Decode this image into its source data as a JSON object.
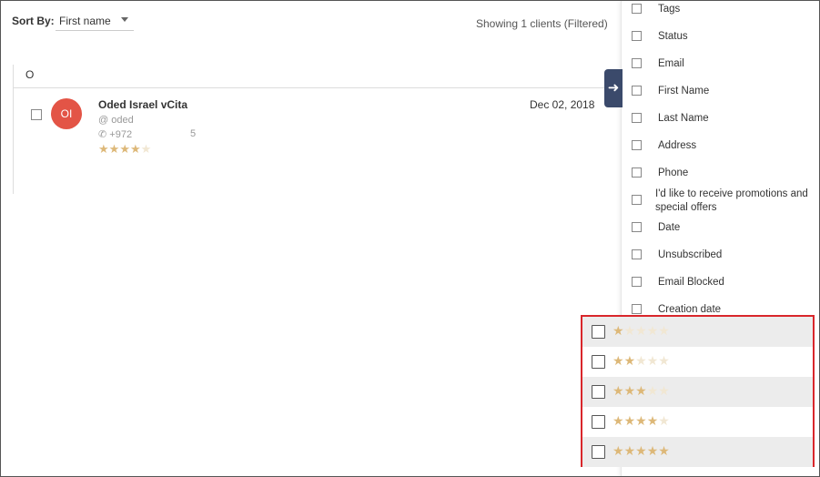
{
  "toolbar": {
    "sort_label": "Sort By:",
    "sort_value": "First name",
    "showing_text": "Showing 1 clients (Filtered)"
  },
  "list": {
    "group_letter": "O",
    "row": {
      "initials": "OI",
      "name": "Oded Israel vCita",
      "email_prefix": "@ oded",
      "phone_prefix": "+972",
      "phone_suffix": "5",
      "rating": 4,
      "date": "Dec 02, 2018"
    }
  },
  "columns": [
    {
      "label": "Tags"
    },
    {
      "label": "Status"
    },
    {
      "label": "Email"
    },
    {
      "label": "First Name"
    },
    {
      "label": "Last Name"
    },
    {
      "label": "Address"
    },
    {
      "label": "Phone"
    },
    {
      "label": "I'd like to receive promotions and special offers"
    },
    {
      "label": "Date"
    },
    {
      "label": "Unsubscribed"
    },
    {
      "label": "Email Blocked"
    },
    {
      "label": "Creation date"
    }
  ],
  "rating_filter": {
    "options": [
      {
        "stars": 1
      },
      {
        "stars": 2
      },
      {
        "stars": 3
      },
      {
        "stars": 4
      },
      {
        "stars": 5
      }
    ],
    "max_stars": 5
  },
  "colors": {
    "avatar": "#e35446",
    "star_filled": "#ddb878",
    "star_empty": "#f1e7d3",
    "highlight_border": "#d9262b",
    "panel_tab": "#3b4a6b"
  },
  "icons": {
    "expand": "arrow-right-icon",
    "email": "at-icon",
    "phone": "phone-icon",
    "sort": "chevron-down-icon"
  }
}
